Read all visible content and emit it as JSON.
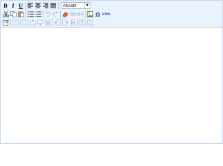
{
  "toolbar": {
    "bold_label": "B",
    "italic_label": "I",
    "underline_label": "U",
    "format_select_value": "Absatz",
    "html_label": "HTML"
  },
  "content": {
    "body_text": ""
  }
}
